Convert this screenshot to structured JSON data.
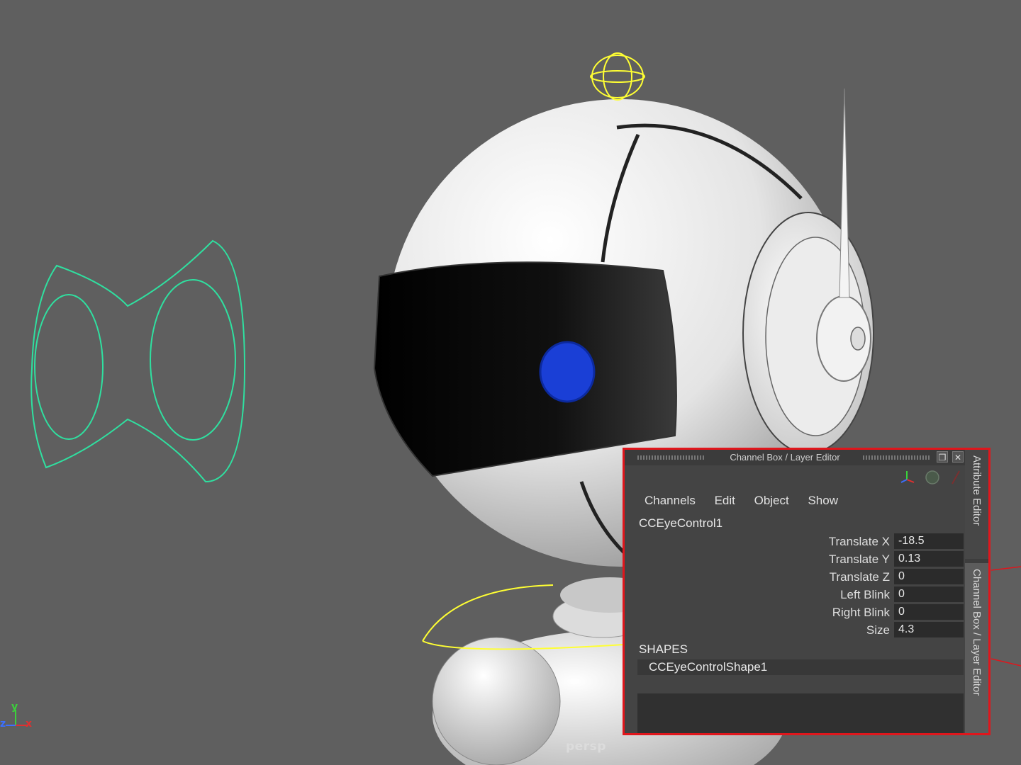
{
  "viewport": {
    "camera_label": "persp",
    "axis": {
      "y": "y",
      "z": "z",
      "x": "x"
    }
  },
  "panel": {
    "title": "Channel Box / Layer Editor",
    "menu": [
      "Channels",
      "Edit",
      "Object",
      "Show"
    ],
    "object_name": "CCEyeControl1",
    "channels": [
      {
        "label": "Translate X",
        "value": "-18.5"
      },
      {
        "label": "Translate Y",
        "value": "0.13"
      },
      {
        "label": "Translate Z",
        "value": "0"
      },
      {
        "label": "Left Blink",
        "value": "0"
      },
      {
        "label": "Right Blink",
        "value": "0"
      },
      {
        "label": "Size",
        "value": "4.3"
      }
    ],
    "shapes_title": "SHAPES",
    "shape_name": "CCEyeControlShape1",
    "side_tabs": {
      "attribute_editor": "Attribute Editor",
      "channel_box": "Channel Box / Layer Editor"
    }
  },
  "colors": {
    "viewport_bg": "#5f5f5f",
    "highlight_border": "#e0161c",
    "control_curve": "#2fe0a0",
    "selection_curve": "#ffff33",
    "eye": "#1a3fd6"
  }
}
